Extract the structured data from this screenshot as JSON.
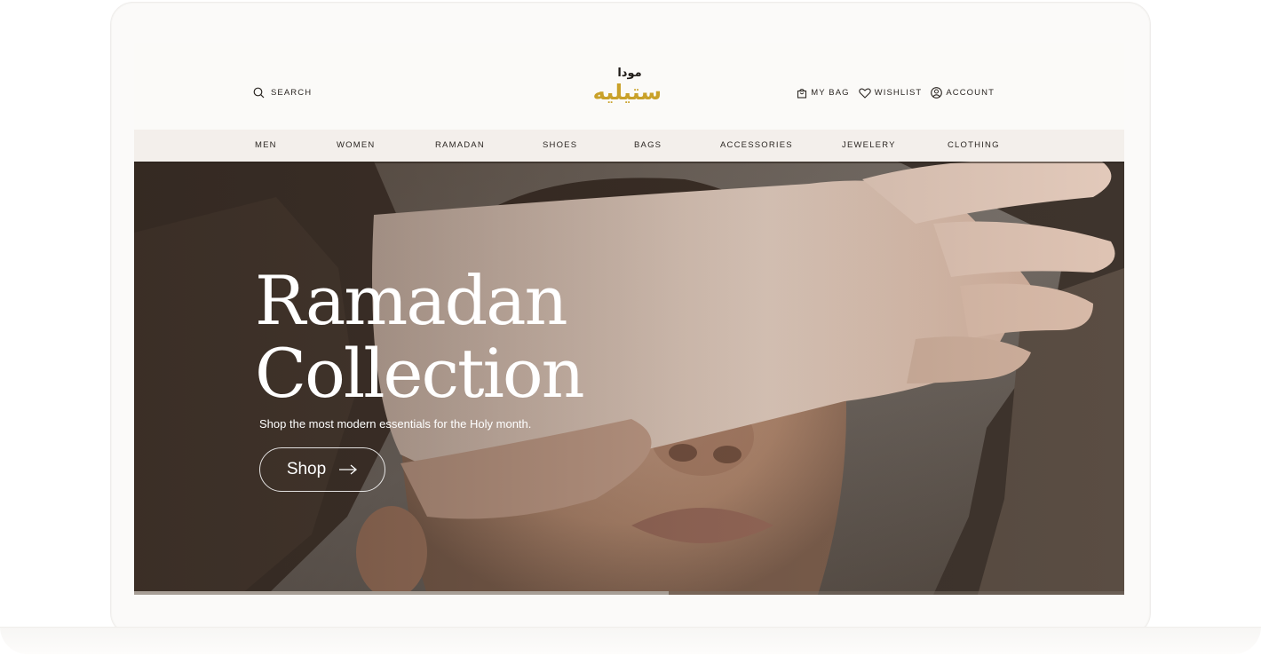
{
  "header": {
    "search_label": "SEARCH",
    "logo_top": "مودا",
    "logo_main": "ستيليه",
    "bag_label": "MY BAG",
    "wishlist_label": "WISHLIST",
    "account_label": "ACCOUNT"
  },
  "nav": {
    "items": [
      {
        "label": "MEN"
      },
      {
        "label": "WOMEN"
      },
      {
        "label": "RAMADAN"
      },
      {
        "label": "SHOES"
      },
      {
        "label": "BAGS"
      },
      {
        "label": "ACCESSORIES"
      },
      {
        "label": "JEWELERY"
      },
      {
        "label": "CLOTHING"
      }
    ]
  },
  "hero": {
    "title_line1": "Ramadan",
    "title_line2": "Collection",
    "subtitle": "Shop the most modern essentials for the Holy month.",
    "button_label": "Shop",
    "slide_progress": 0.54
  },
  "colors": {
    "brand_gold": "#c9a12a",
    "nav_bg": "#f3efeb",
    "text_dark": "#2b2622"
  },
  "icons": [
    "search-icon",
    "bag-icon",
    "heart-icon",
    "user-icon",
    "arrow-right-icon"
  ]
}
